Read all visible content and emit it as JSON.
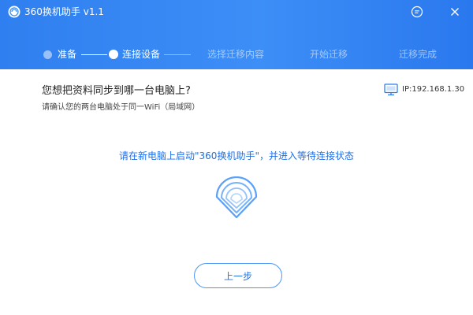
{
  "app": {
    "title": "360换机助手 v1.1"
  },
  "steps": [
    {
      "label": "准备",
      "state": "done"
    },
    {
      "label": "连接设备",
      "state": "active"
    },
    {
      "label": "选择迁移内容",
      "state": "pending"
    },
    {
      "label": "开始迁移",
      "state": "pending"
    },
    {
      "label": "迁移完成",
      "state": "pending"
    }
  ],
  "content": {
    "title": "您想把资料同步到哪一台电脑上?",
    "subtitle": "请确认您的两台电脑处于同一WiFi（局域网）",
    "ip": "IP:192.168.1.30",
    "instruction": "请在新电脑上启动\"360换机助手\"，并进入等待连接状态",
    "back_label": "上一步"
  },
  "colors": {
    "header_blue": "#3d8ef7",
    "accent_blue": "#1e6fe8"
  },
  "icons": [
    "logo-icon",
    "feedback-icon",
    "close-icon",
    "computer-icon",
    "wifi-signal-icon"
  ]
}
